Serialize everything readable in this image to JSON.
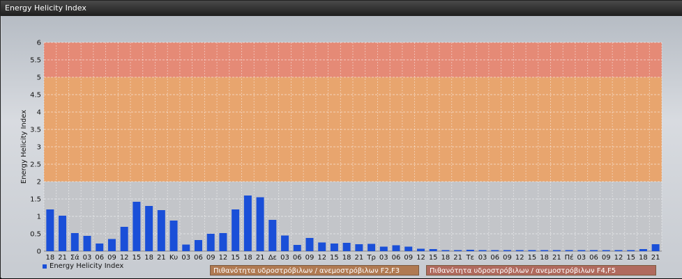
{
  "window": {
    "title": "Energy Helicity Index"
  },
  "chart_data": {
    "type": "bar",
    "ylabel": "Energy Helicity Index",
    "ylim": [
      0,
      6
    ],
    "yticks": [
      "0",
      "0.5",
      "1",
      "1.5",
      "2",
      "2.5",
      "3",
      "3.5",
      "4",
      "4.5",
      "5",
      "5.5",
      "6"
    ],
    "categories": [
      "18",
      "21",
      "Σά",
      "03",
      "06",
      "09",
      "12",
      "15",
      "18",
      "21",
      "Κυ",
      "03",
      "06",
      "09",
      "12",
      "15",
      "18",
      "21",
      "Δε",
      "03",
      "06",
      "09",
      "12",
      "15",
      "18",
      "21",
      "Τρ",
      "03",
      "06",
      "09",
      "12",
      "15",
      "18",
      "21",
      "Τε",
      "03",
      "06",
      "09",
      "12",
      "15",
      "18",
      "21",
      "Πέ",
      "03",
      "06",
      "09",
      "12",
      "15",
      "18",
      "21"
    ],
    "series": [
      {
        "name": "Energy Helicity Index",
        "color": "#1a4fd8",
        "values": [
          1.2,
          1.02,
          0.52,
          0.44,
          0.22,
          0.35,
          0.7,
          1.42,
          1.3,
          1.18,
          0.88,
          0.19,
          0.32,
          0.5,
          0.52,
          1.2,
          1.6,
          1.55,
          0.9,
          0.45,
          0.18,
          0.38,
          0.25,
          0.22,
          0.24,
          0.2,
          0.21,
          0.13,
          0.17,
          0.13,
          0.07,
          0.06,
          0.03,
          0.03,
          0.04,
          0.03,
          0.03,
          0.03,
          0.03,
          0.03,
          0.03,
          0.03,
          0.03,
          0.03,
          0.03,
          0.03,
          0.03,
          0.03,
          0.06,
          0.2
        ]
      }
    ],
    "bands": [
      {
        "from": 0,
        "to": 2,
        "color": "#c3c5c9"
      },
      {
        "from": 2,
        "to": 5,
        "color": "#e8a56e"
      },
      {
        "from": 5,
        "to": 6,
        "color": "#e58a76"
      }
    ],
    "grid": true
  },
  "legend": {
    "series_label": "Energy Helicity Index",
    "band1_label": "Πιθανότητα υδροστρόβιλων / ανεμοστρόβιλων F2,F3",
    "band2_label": "Πιθανότητα υδροστρόβιλων / ανεμοστρόβιλων F4,F5"
  }
}
